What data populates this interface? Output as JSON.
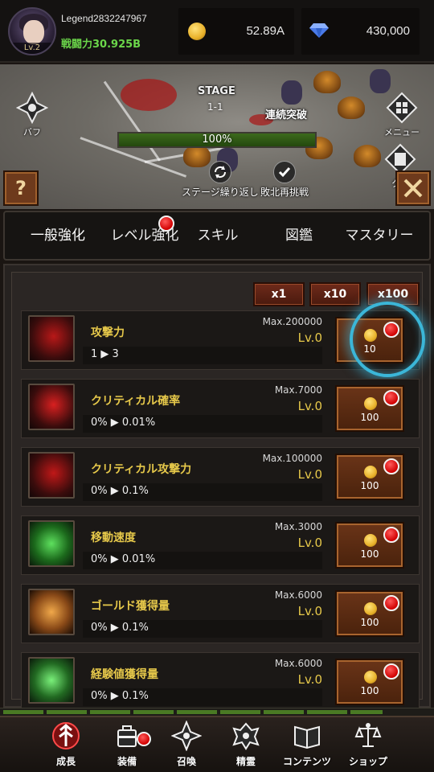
{
  "header": {
    "player_name": "Legend2832247967",
    "avatar_level": "Lv.2",
    "battle_power": "戦闘力30.925B",
    "gold": "52.89A",
    "gems": "430,000"
  },
  "battle": {
    "stage_label": "STAGE",
    "stage_number": "1-1",
    "combo_label": "連続突破",
    "progress_percent": 100,
    "progress_text": "100%",
    "buff_label": "バフ",
    "menu_label": "メニュー",
    "quest_label": "クエ",
    "stage_repeat_label": "ステージ繰り返し",
    "retry_label": "敗北再挑戦",
    "player_tag": "2832247967"
  },
  "tabs": [
    {
      "label": "一般強化",
      "active": true
    },
    {
      "label": "レベル強化",
      "active": false,
      "notification": true
    },
    {
      "label": "スキル",
      "active": false
    },
    {
      "label": "図鑑",
      "active": false
    },
    {
      "label": "マスタリー",
      "active": false
    }
  ],
  "multipliers": [
    "x1",
    "x10",
    "x100"
  ],
  "upgrades": [
    {
      "name": "攻撃力",
      "value": "1 ▶ 3",
      "max": "Max.200000",
      "level": "Lv.0",
      "cost": "10",
      "icon": "sword-slash-icon",
      "color": "#b81818"
    },
    {
      "name": "クリティカル確率",
      "value": "0% ▶ 0.01%",
      "max": "Max.7000",
      "level": "Lv.0",
      "cost": "100",
      "icon": "critical-burst-icon",
      "color": "#d82020"
    },
    {
      "name": "クリティカル攻撃力",
      "value": "0% ▶ 0.1%",
      "max": "Max.100000",
      "level": "Lv.0",
      "cost": "100",
      "icon": "critical-claw-icon",
      "color": "#c01818"
    },
    {
      "name": "移動速度",
      "value": "0% ▶ 0.01%",
      "max": "Max.3000",
      "level": "Lv.0",
      "cost": "100",
      "icon": "boot-icon",
      "color": "#2c9a2c"
    },
    {
      "name": "ゴールド獲得量",
      "value": "0% ▶ 0.1%",
      "max": "Max.6000",
      "level": "Lv.0",
      "cost": "100",
      "icon": "gold-coins-icon",
      "color": "#c87820"
    },
    {
      "name": "経験値獲得量",
      "value": "0% ▶ 0.1%",
      "max": "Max.6000",
      "level": "Lv.0",
      "cost": "100",
      "icon": "experience-icon",
      "color": "#38a838"
    }
  ],
  "nav": [
    {
      "label": "成長",
      "icon": "growth-icon",
      "active": true
    },
    {
      "label": "装備",
      "icon": "equipment-icon",
      "notification": true
    },
    {
      "label": "召喚",
      "icon": "summon-icon"
    },
    {
      "label": "精霊",
      "icon": "spirit-icon"
    },
    {
      "label": "コンテンツ",
      "icon": "contents-book-icon"
    },
    {
      "label": "ショップ",
      "icon": "shop-scale-icon"
    }
  ]
}
